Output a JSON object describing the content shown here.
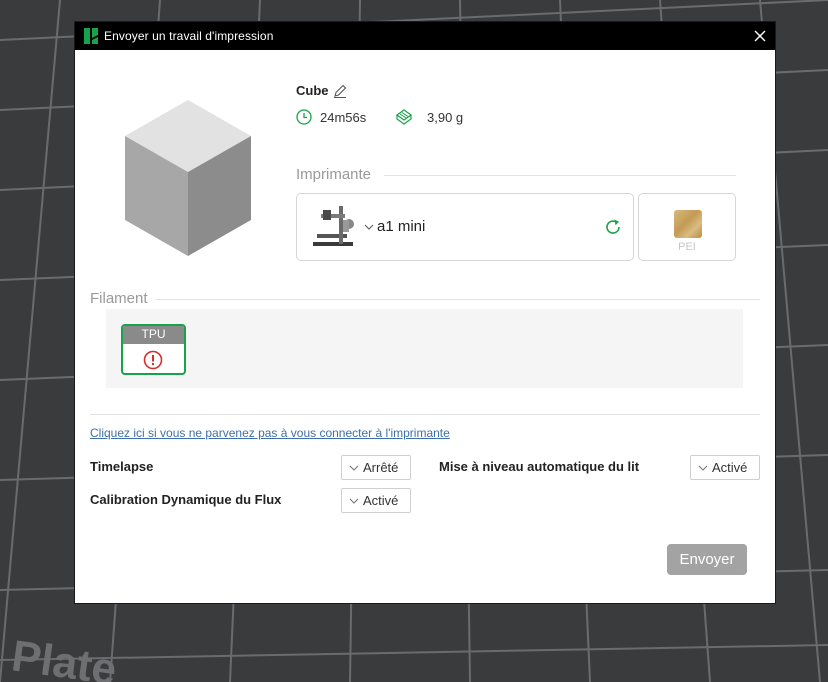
{
  "window": {
    "title": "Envoyer un travail d'impression"
  },
  "model": {
    "name": "Cube",
    "time": "24m56s",
    "weight": "3,90 g"
  },
  "printer_section": {
    "label": "Imprimante",
    "printer_name": "a1 mini",
    "plate_label": "PEI"
  },
  "filament_section": {
    "label": "Filament",
    "slots": [
      {
        "type": "TPU",
        "status": "warning"
      }
    ]
  },
  "connect_link": "Cliquez ici si vous ne parvenez pas à vous connecter à l'imprimante",
  "options": {
    "timelapse": {
      "label": "Timelapse",
      "value": "Arrêté"
    },
    "bed_leveling": {
      "label": "Mise à niveau automatique du lit",
      "value": "Activé"
    },
    "flow_calibration": {
      "label": "Calibration Dynamique du Flux",
      "value": "Activé"
    }
  },
  "send_button": "Envoyer",
  "background_text": "Plate",
  "colors": {
    "accent_green": "#16a34a",
    "warning_red": "#d32f2f",
    "titlebar": "#000000",
    "button_disabled": "#a3a3a3",
    "link": "#3d70a8"
  }
}
